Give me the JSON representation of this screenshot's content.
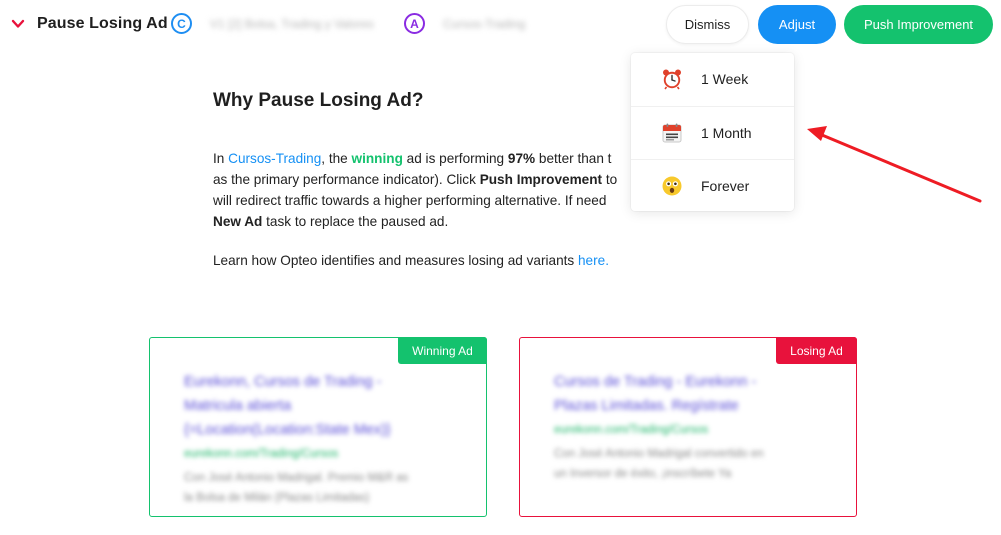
{
  "header": {
    "title": "Pause Losing Ad",
    "campaign_badge": "C",
    "campaign_name": "V1 [2] Bolsa, Trading y Valores",
    "adgroup_badge": "A",
    "adgroup_name": "Cursos-Trading",
    "dismiss_label": "Dismiss",
    "adjust_label": "Adjust",
    "push_label": "Push Improvement"
  },
  "dropdown": {
    "items": [
      {
        "label": "1 Week",
        "icon": "alarm-clock-icon"
      },
      {
        "label": "1 Month",
        "icon": "calendar-icon"
      },
      {
        "label": "Forever",
        "icon": "astonished-face-icon"
      }
    ]
  },
  "content": {
    "heading": "Why Pause Losing Ad?",
    "p1": {
      "in": "In ",
      "adgroup_link": "Cursos-Trading",
      "the": ", the ",
      "winning": "winning",
      "ad_is": " ad is performing ",
      "pct": "97%",
      "better_than": " better than t",
      "line2": "as the primary performance indicator). Click ",
      "push_strong": "Push Improvement",
      "to": " to",
      "line3": "will redirect traffic towards a higher performing alternative. If need",
      "new_ad_strong": "New Ad",
      "line4_rest": " task to replace the paused ad."
    },
    "p2": {
      "text": "Learn how Opteo identifies and measures losing ad variants ",
      "link": "here."
    }
  },
  "ads": {
    "winning": {
      "tag": "Winning Ad",
      "headline1": "Eurekonn, Cursos de Trading -",
      "headline2": "Matricula abierta",
      "headline3": "{=Location(Location:State Mex)}",
      "url": "eurekonn.com/Trading/Cursos",
      "desc1": "Con José Antonio Madrigal. Premio M&R as",
      "desc2": "la Bolsa de Milán (Plazas Limitadas)"
    },
    "losing": {
      "tag": "Losing Ad",
      "headline1": "Cursos de Trading - Eurekonn -",
      "headline2": "Plazas Limitadas. Regístrate",
      "url": "eurekonn.com/Trading/Cursos",
      "desc1": "Con José Antonio Madrigal convertido en",
      "desc2": "un Inversor de éxito, ¡inscríbete Ya"
    }
  },
  "colors": {
    "blue": "#1590f4",
    "green": "#14c26e",
    "red": "#e8123c",
    "purple": "#8a2be2",
    "annotation_arrow": "#ee1c24"
  }
}
